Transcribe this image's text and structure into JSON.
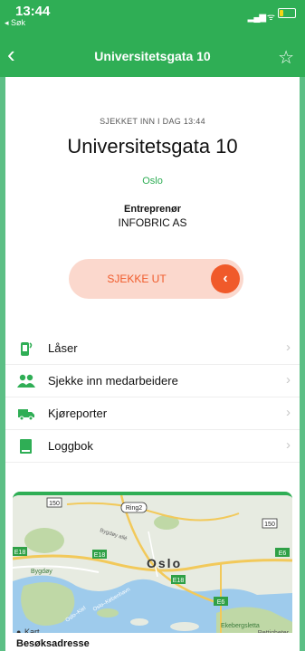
{
  "status_bar": {
    "time": "13:44",
    "back_app": "◂ Søk",
    "signal": "▂▄▆ ᯤ",
    "battery_color": "#f5d515",
    "battery_level": 0.25
  },
  "nav": {
    "title": "Universitetsgata 10",
    "back_icon": "chevron-left",
    "favorite_icon": "star-outline"
  },
  "checkin": {
    "status": "SJEKKET INN I DAG 13:44",
    "site_name": "Universitetsgata 10",
    "city": "Oslo",
    "contractor_label": "Entreprenør",
    "contractor": "INFOBRIC AS",
    "checkout_label": "SJEKKE UT",
    "checkout_icon": "chevron-left"
  },
  "menu": [
    {
      "label": "Låser",
      "icon": "lock-phone-icon"
    },
    {
      "label": "Sjekke inn medarbeidere",
      "icon": "people-icon"
    },
    {
      "label": "Kjøreporter",
      "icon": "truck-icon"
    },
    {
      "label": "Loggbok",
      "icon": "book-icon"
    }
  ],
  "map": {
    "city_label": "Oslo",
    "roads": [
      "150",
      "Ring2",
      "150",
      "E18",
      "E18",
      "E6",
      "E18",
      "E6"
    ],
    "places": [
      "Bygdøy",
      "Ekebergsletta",
      "Bygdøy allé",
      "Oslo–Kiel",
      "Oslo–København"
    ],
    "attribution": "Kart",
    "legal": "Rettigheter"
  },
  "address": {
    "label": "Besøksadresse"
  },
  "colors": {
    "brand_green": "#2fae55",
    "accent_orange": "#f05a2a",
    "checkout_bg": "#fbd8cd"
  }
}
